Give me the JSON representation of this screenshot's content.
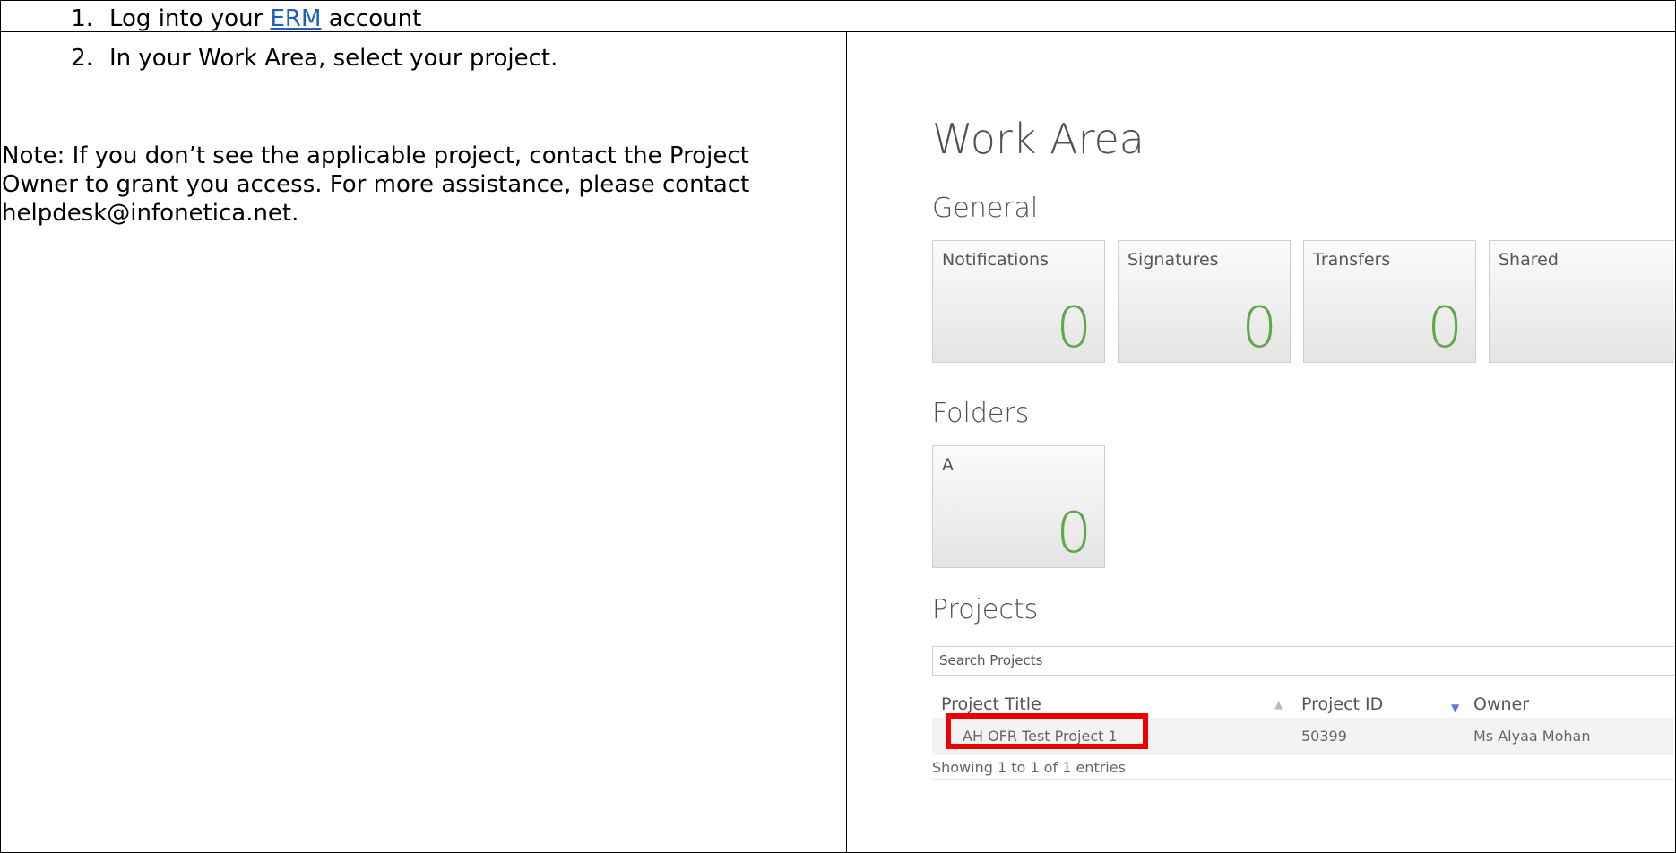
{
  "steps": [
    {
      "num": "1.",
      "prefix": "Log into your ",
      "link": "ERM",
      "suffix": " account"
    },
    {
      "num": "2.",
      "text": "In your Work Area, select your project."
    }
  ],
  "note": "Note: If you don’t see the applicable project, contact the Project Owner to grant you access. For more assistance, please contact helpdesk@infonetica.net.",
  "work_area": {
    "title": "Work Area",
    "general_heading": "General",
    "general_tiles": [
      {
        "label": "Notifications",
        "count": "0"
      },
      {
        "label": "Signatures",
        "count": "0"
      },
      {
        "label": "Transfers",
        "count": "0"
      },
      {
        "label": "Shared",
        "count": ""
      }
    ],
    "folders_heading": "Folders",
    "folder_tiles": [
      {
        "label": "A",
        "count": "0"
      }
    ],
    "projects_heading": "Projects",
    "search_placeholder": "Search Projects",
    "columns": [
      "Project Title",
      "Project ID",
      "Owner"
    ],
    "rows": [
      {
        "title": "AH OFR Test Project 1",
        "id": "50399",
        "owner": "Ms Alyaa Mohan"
      }
    ],
    "footer": "Showing 1 to 1 of 1 entries",
    "sort_icons": [
      "sort-both-icon",
      "sort-desc-icon"
    ]
  },
  "colors": {
    "link": "#1f5fbf",
    "count": "#5ea84a",
    "highlight": "#ee0000"
  }
}
